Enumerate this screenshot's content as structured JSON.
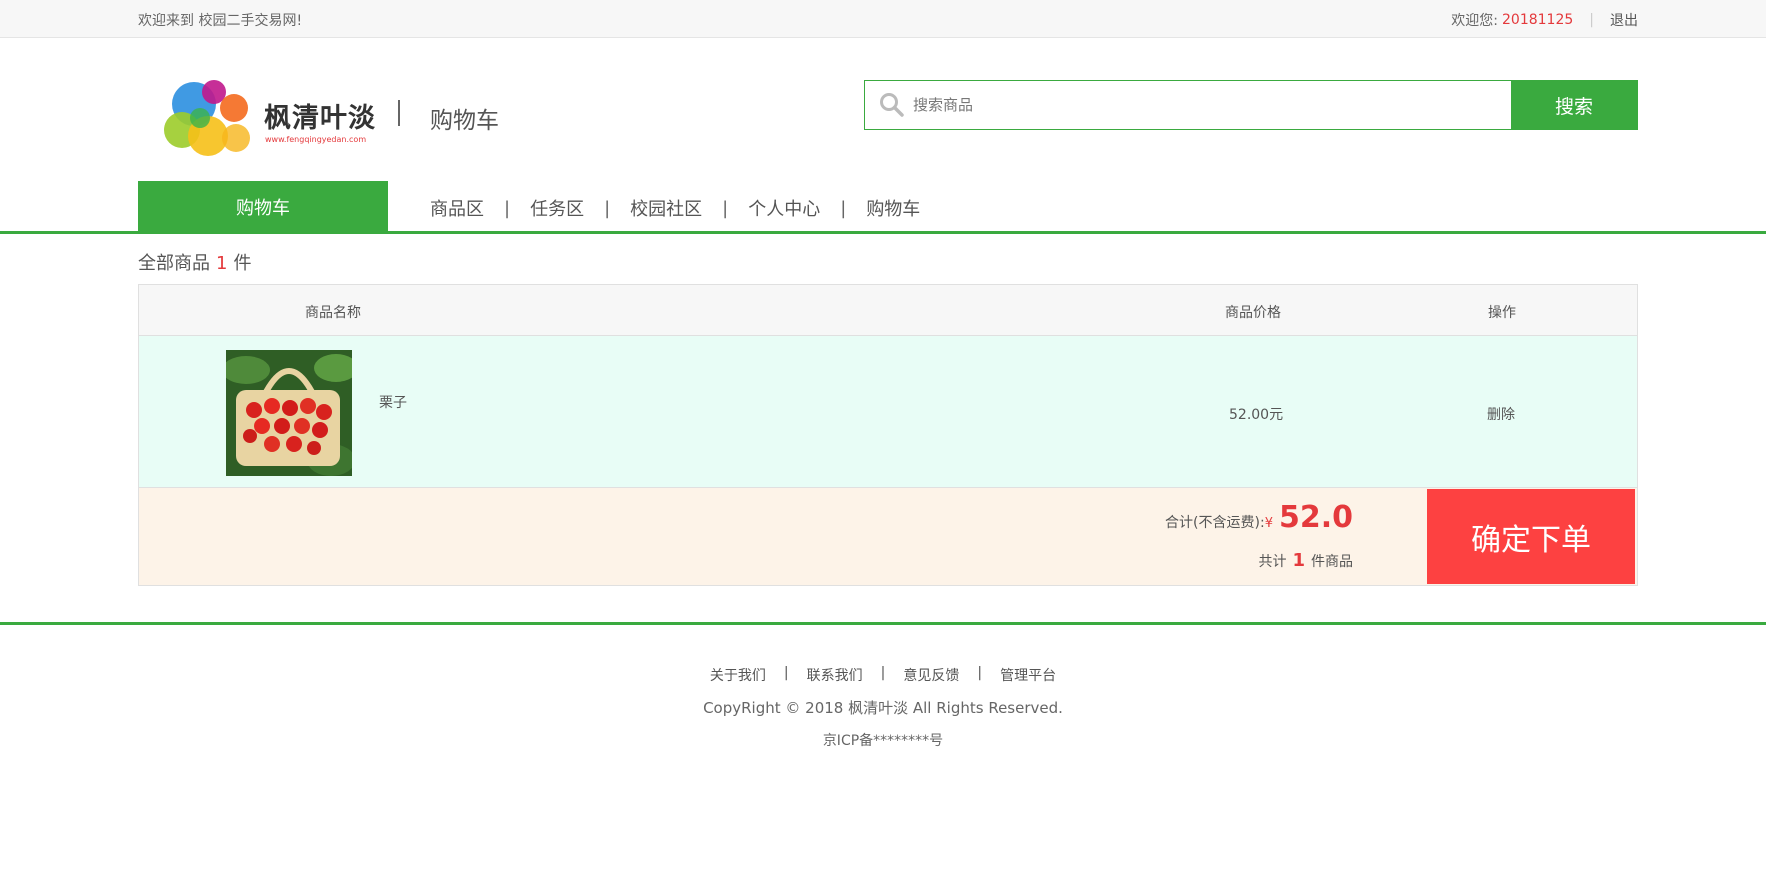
{
  "topbar": {
    "welcome": "欢迎来到 校园二手交易网!",
    "greeting": "欢迎您:",
    "username": "20181125",
    "separator": "|",
    "logout": "退出"
  },
  "header": {
    "logo_text": "枫清叶淡",
    "logo_url": "www.fengqingyedan.com",
    "page_title": "购物车"
  },
  "search": {
    "placeholder": "搜索商品",
    "button_label": "搜索"
  },
  "nav": {
    "active": "购物车",
    "items": [
      "商品区",
      "任务区",
      "校园社区",
      "个人中心",
      "购物车"
    ],
    "separator": "|"
  },
  "cart": {
    "count_prefix": "全部商品",
    "count": "1",
    "count_suffix": "件",
    "columns": [
      "商品名称",
      "商品价格",
      "操作"
    ],
    "items": [
      {
        "name": "栗子",
        "price": "52.00元",
        "action": "删除"
      }
    ],
    "total_label": "合计(不含运费):",
    "currency": "¥",
    "total": "52.0",
    "qty_prefix": "共计",
    "qty": "1",
    "qty_suffix": "件商品",
    "confirm_label": "确定下单"
  },
  "footer": {
    "links": [
      "关于我们",
      "联系我们",
      "意见反馈",
      "管理平台"
    ],
    "separator": "|",
    "copyright": "CopyRight © 2018 枫清叶淡 All Rights Reserved.",
    "icp": "京ICP备********号"
  },
  "colors": {
    "accent_green": "#3aaa3f",
    "price_red": "#e4393c",
    "confirm_red": "#fd4141",
    "row_bg": "#e8fdf6",
    "footer_bg": "#fdf3e8"
  }
}
